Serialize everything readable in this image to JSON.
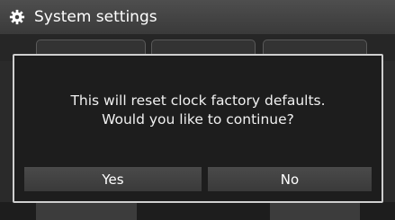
{
  "window": {
    "title": "System settings",
    "icon": "gear-icon"
  },
  "dialog": {
    "message_line1": "This will reset clock factory defaults.",
    "message_line2": "Would you like to continue?",
    "yes_label": "Yes",
    "no_label": "No"
  },
  "colors": {
    "background": "#2a2a2a",
    "dialog_background": "#1d1d1d",
    "dialog_border": "#cfcfcf",
    "button": "#444444",
    "text": "#ffffff"
  }
}
